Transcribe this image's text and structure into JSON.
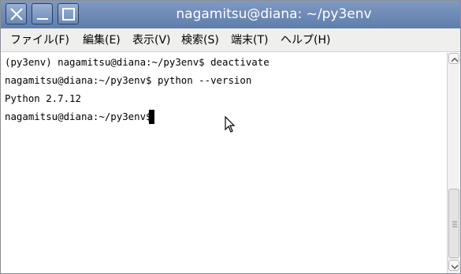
{
  "window": {
    "title": "nagamitsu@diana: ~/py3env"
  },
  "titlebar_buttons": [
    {
      "name": "close-icon"
    },
    {
      "name": "minimize-icon"
    },
    {
      "name": "maximize-icon"
    }
  ],
  "menu": {
    "file": "ファイル(F)",
    "edit": "編集(E)",
    "view": "表示(V)",
    "search": "検索(S)",
    "terminal": "端末(T)",
    "help": "ヘルプ(H)"
  },
  "terminal": {
    "lines": [
      "(py3env) nagamitsu@diana:~/py3env$ deactivate",
      "nagamitsu@diana:~/py3env$ python --version",
      "Python 2.7.12",
      "nagamitsu@diana:~/py3env$"
    ]
  },
  "scrollbar": {
    "position": 1.0
  },
  "colors": {
    "titlebar": "#6f8bb6",
    "menubar": "#efefee",
    "terminal_bg": "#ffffff",
    "terminal_fg": "#000000"
  }
}
